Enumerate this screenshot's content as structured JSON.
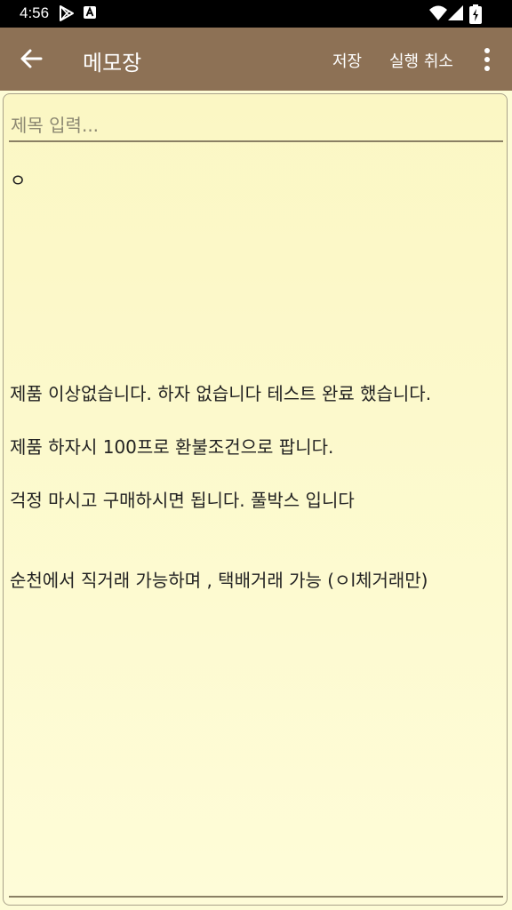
{
  "status_bar": {
    "time": "4:56",
    "icons": [
      "play-store-icon",
      "a-notification-icon",
      "wifi-icon",
      "cell-signal-icon",
      "battery-icon"
    ]
  },
  "app_bar": {
    "title": "메모장",
    "save_label": "저장",
    "undo_label": "실행 취소",
    "back_icon": "arrow-left-icon",
    "more_icon": "more-vert-icon"
  },
  "editor": {
    "title_value": "",
    "title_placeholder": "제목 입력...",
    "body": "ㅇ\n\n\n\n\n\n\n\n제품 이상없습니다. 하자 없습니다 테스트 완료 했습니다.\n\n제품 하자시 100프로 환불조건으로 팝니다.\n\n걱정 마시고 구매하시면 됩니다. 풀박스 입니다\n\n\n순천에서 직거래 가능하며 , 택배거래 가능 (ㅇl체거래만)"
  },
  "colors": {
    "app_bar": "#8d7155",
    "editor_background": "#fcf9cc",
    "underline": "#8a8064"
  }
}
